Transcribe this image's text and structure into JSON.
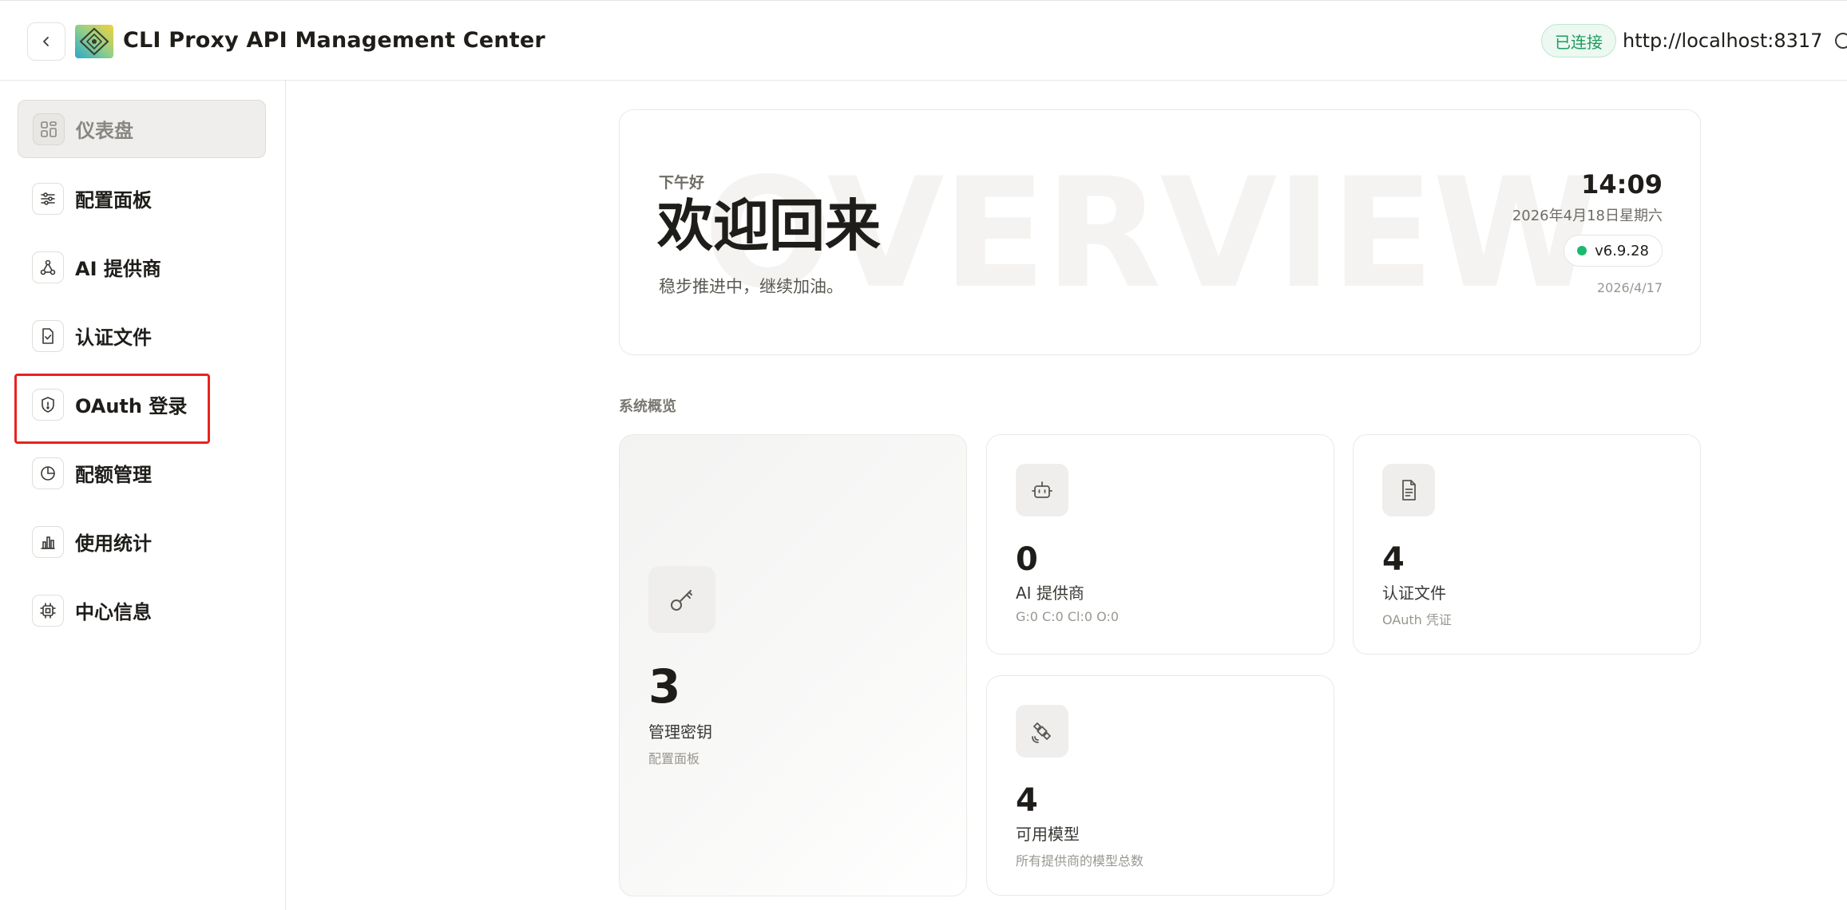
{
  "header": {
    "app_title": "CLI Proxy API Management Center",
    "connection_status": "已连接",
    "server_url": "http://localhost:8317",
    "back_icon": "chevron-left-icon",
    "search_icon": "search-icon"
  },
  "sidebar": {
    "items": [
      {
        "label": "仪表盘",
        "icon": "dashboard-grid-icon",
        "active": true
      },
      {
        "label": "配置面板",
        "icon": "sliders-icon",
        "active": false
      },
      {
        "label": "AI 提供商",
        "icon": "network-nodes-icon",
        "active": false
      },
      {
        "label": "认证文件",
        "icon": "file-check-icon",
        "active": false
      },
      {
        "label": "OAuth 登录",
        "icon": "shield-icon",
        "active": false
      },
      {
        "label": "配额管理",
        "icon": "pie-chart-icon",
        "active": false
      },
      {
        "label": "使用统计",
        "icon": "bar-chart-icon",
        "active": false
      },
      {
        "label": "中心信息",
        "icon": "chip-icon",
        "active": false
      }
    ],
    "highlight_color": "#e8231f"
  },
  "hero": {
    "watermark": "OVERVIEW",
    "greeting": "下午好",
    "welcome": "欢迎回来",
    "subline": "稳步推进中，继续加油。",
    "time": "14:09",
    "date": "2026年4月18日星期六",
    "version": "v6.9.28",
    "build_date": "2026/4/17"
  },
  "overview": {
    "section_label": "系统概览",
    "cards": [
      {
        "value": "3",
        "title": "管理密钥",
        "sub": "配置面板",
        "icon": "key-icon"
      },
      {
        "value": "0",
        "title": "AI 提供商",
        "sub": "G:0 C:0 Cl:0 O:0",
        "icon": "robot-icon"
      },
      {
        "value": "4",
        "title": "认证文件",
        "sub": "OAuth 凭证",
        "icon": "document-icon"
      },
      {
        "value": "4",
        "title": "可用模型",
        "sub": "所有提供商的模型总数",
        "icon": "satellite-icon"
      }
    ]
  },
  "colors": {
    "accent_green": "#1d9b5d",
    "status_dot": "#1eb870",
    "text_primary": "#1f1d1a"
  }
}
